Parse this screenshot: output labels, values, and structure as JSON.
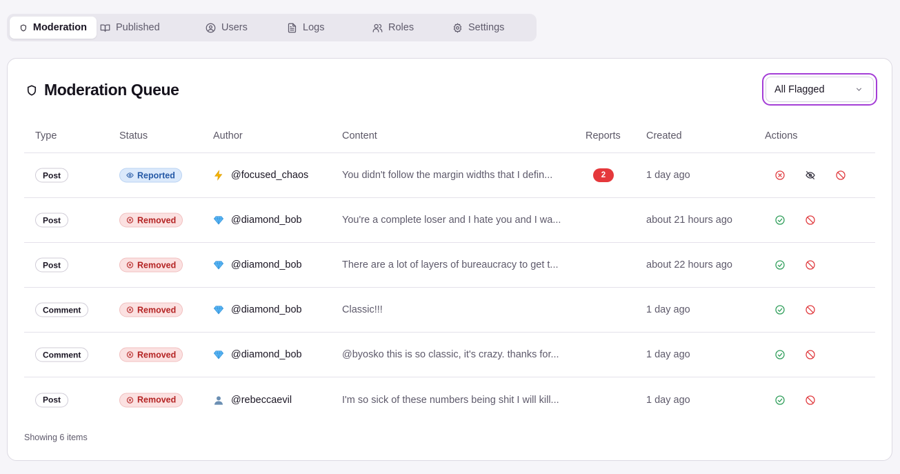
{
  "tabs": [
    {
      "label": "Moderation",
      "icon": "shield-icon",
      "active": true
    },
    {
      "label": "Published",
      "icon": "book-icon",
      "active": false
    },
    {
      "label": "Users",
      "icon": "user-circle-icon",
      "active": false
    },
    {
      "label": "Logs",
      "icon": "file-text-icon",
      "active": false
    },
    {
      "label": "Roles",
      "icon": "users-icon",
      "active": false
    },
    {
      "label": "Settings",
      "icon": "gear-icon",
      "active": false
    }
  ],
  "queue": {
    "title": "Moderation Queue",
    "filter": {
      "selected": "All Flagged"
    }
  },
  "table": {
    "headers": {
      "type": "Type",
      "status": "Status",
      "author": "Author",
      "content": "Content",
      "reports": "Reports",
      "created": "Created",
      "actions": "Actions"
    },
    "rows": [
      {
        "type": "Post",
        "status": "Reported",
        "author_icon": "lightning-icon",
        "author": "@focused_chaos",
        "content": "You didn't follow the margin widths that I defin...",
        "reports": "2",
        "created": "1 day ago"
      },
      {
        "type": "Post",
        "status": "Removed",
        "author_icon": "diamond-icon",
        "author": "@diamond_bob",
        "content": "You're a complete loser and I hate you and I wa...",
        "reports": "",
        "created": "about 21 hours ago"
      },
      {
        "type": "Post",
        "status": "Removed",
        "author_icon": "diamond-icon",
        "author": "@diamond_bob",
        "content": "There are a lot of layers of bureaucracy to get t...",
        "reports": "",
        "created": "about 22 hours ago"
      },
      {
        "type": "Comment",
        "status": "Removed",
        "author_icon": "diamond-icon",
        "author": "@diamond_bob",
        "content": "Classic!!!",
        "reports": "",
        "created": "1 day ago"
      },
      {
        "type": "Comment",
        "status": "Removed",
        "author_icon": "diamond-icon",
        "author": "@diamond_bob",
        "content": "@byosko this is so classic, it's crazy. thanks for...",
        "reports": "",
        "created": "1 day ago"
      },
      {
        "type": "Post",
        "status": "Removed",
        "author_icon": "person-icon",
        "author": "@rebeccaevil",
        "content": "I'm so sick of these numbers being shit I will kill...",
        "reports": "",
        "created": "1 day ago"
      }
    ]
  },
  "footer": {
    "text": "Showing 6 items"
  },
  "colors": {
    "accent": "#a43ed6",
    "reported_bg": "#dbe9fb",
    "removed_bg": "#fbe1e1",
    "badge": "#e5383b",
    "approve": "#2f9e5a",
    "danger": "#e03a3e"
  }
}
